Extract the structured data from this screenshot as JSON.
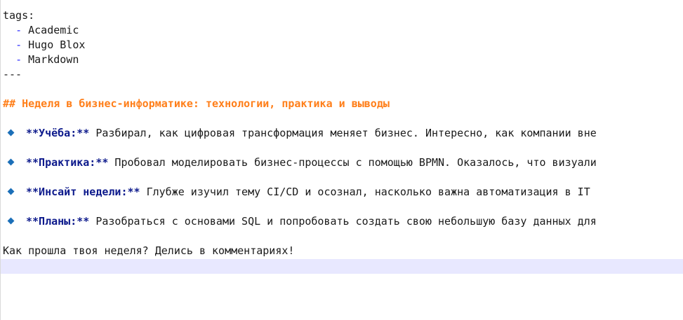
{
  "frontmatter": {
    "tags_key": "tags:",
    "tags": [
      "Academic",
      "Hugo Blox",
      "Markdown"
    ],
    "separator": "---"
  },
  "heading": "## Неделя в бизнес-информатике: технологии, практика и выводы",
  "list": [
    {
      "label": "**Учёба:**",
      "text": " Разбирал, как цифровая трансформация меняет бизнес. Интересно, как компании вне"
    },
    {
      "label": "**Практика:**",
      "text": " Пробовал моделировать бизнес-процессы с помощью BPMN. Оказалось, что визуали"
    },
    {
      "label": "**Инсайт недели:**",
      "text": " Глубже изучил тему CI/CD и осознал, насколько важна автоматизация в IT"
    },
    {
      "label": "**Планы:**",
      "text": " Разобраться с основами SQL и попробовать создать свою небольшую базу данных для"
    }
  ],
  "closing": "Как прошла твоя неделя? Делись в комментариях!",
  "colors": {
    "heading": "#ff7f1a",
    "bold": "#0d1a8c",
    "bullet": "#1b6fb8",
    "current_line": "#e8e8ff"
  }
}
